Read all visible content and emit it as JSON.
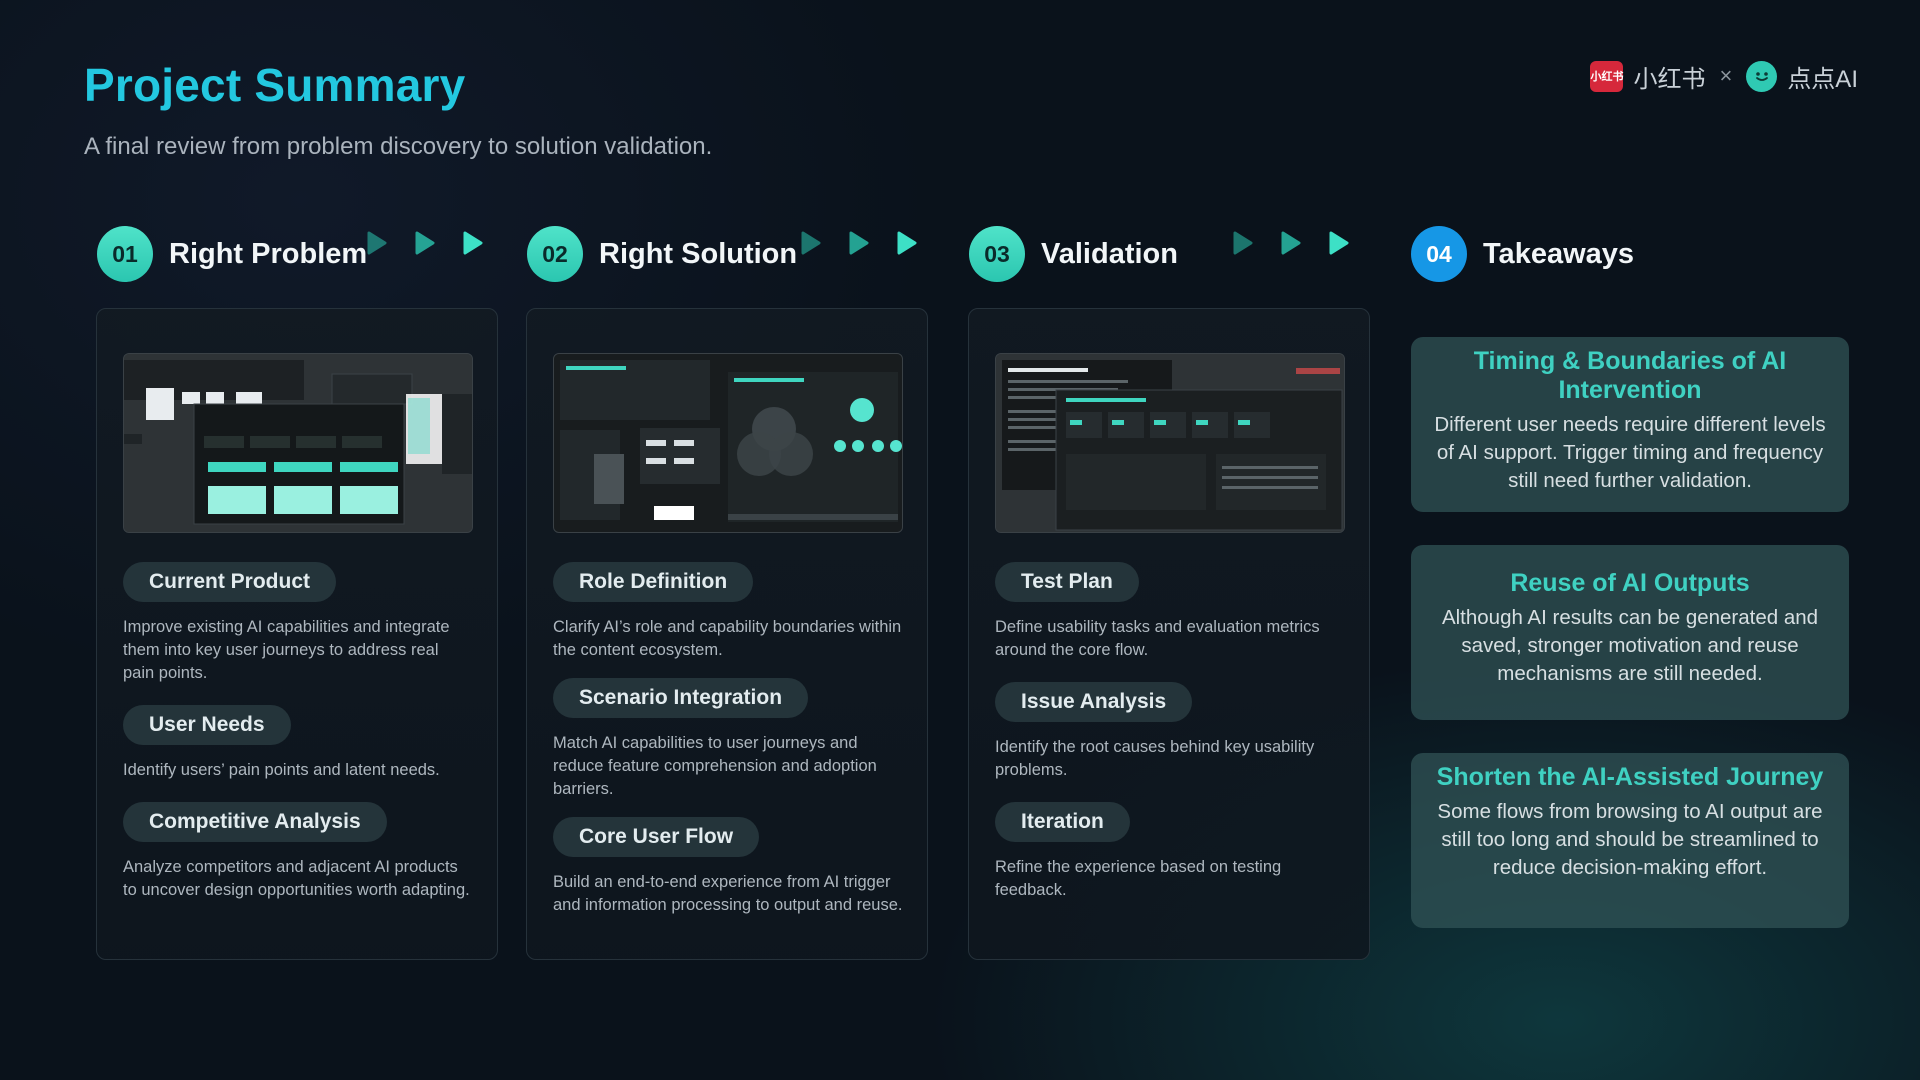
{
  "header": {
    "title": "Project Summary",
    "subtitle": "A final review from problem discovery to solution validation.",
    "brand": {
      "xhs_logo_text": "小红书",
      "xhs_name": "小红书",
      "separator": "×",
      "dd_name": "点点AI"
    }
  },
  "colors": {
    "title": "#23c8e0",
    "step_number_teal": "#2bc6b0",
    "step_number_blue": "#1697e6",
    "takeaway_heading": "#3fd1c2",
    "background": "#0a121b"
  },
  "steps": [
    {
      "number": "01",
      "label": "Right Problem"
    },
    {
      "number": "02",
      "label": "Right Solution"
    },
    {
      "number": "03",
      "label": "Validation"
    },
    {
      "number": "04",
      "label": "Takeaways"
    }
  ],
  "columns": [
    {
      "screenshot_icon": "project-screenshot-thumbnail",
      "sections": [
        {
          "tag": "Current Product",
          "text": "Improve existing AI capabilities and integrate them into key user journeys to address real pain points."
        },
        {
          "tag": "User Needs",
          "text": "Identify users’ pain points and latent needs."
        },
        {
          "tag": "Competitive Analysis",
          "text": "Analyze competitors and adjacent AI products to uncover design opportunities worth adapting."
        }
      ]
    },
    {
      "screenshot_icon": "solution-screenshot-thumbnail",
      "sections": [
        {
          "tag": "Role Definition",
          "text": "Clarify AI’s role and capability boundaries within the content ecosystem."
        },
        {
          "tag": "Scenario Integration",
          "text": "Match AI capabilities to user journeys and reduce feature comprehension and adoption barriers."
        },
        {
          "tag": "Core User Flow",
          "text": "Build an end-to-end experience from AI trigger and information processing to output and reuse."
        }
      ]
    },
    {
      "screenshot_icon": "validation-screenshot-thumbnail",
      "sections": [
        {
          "tag": "Test Plan",
          "text": "Define usability tasks and evaluation metrics around the core flow."
        },
        {
          "tag": "Issue Analysis",
          "text": "Identify the root causes behind key usability problems."
        },
        {
          "tag": "Iteration",
          "text": "Refine the experience based on testing feedback."
        }
      ]
    }
  ],
  "takeaways": [
    {
      "title": "Timing & Boundaries of AI Intervention",
      "text": "Different user needs require different levels of AI support. Trigger timing and frequency still need further validation."
    },
    {
      "title": "Reuse of AI Outputs",
      "text": "Although AI results can be generated and saved, stronger motivation and reuse mechanisms are still needed."
    },
    {
      "title": "Shorten the AI-Assisted Journey",
      "text": "Some flows from browsing to AI output are still too long and should be streamlined to reduce decision-making effort."
    }
  ]
}
